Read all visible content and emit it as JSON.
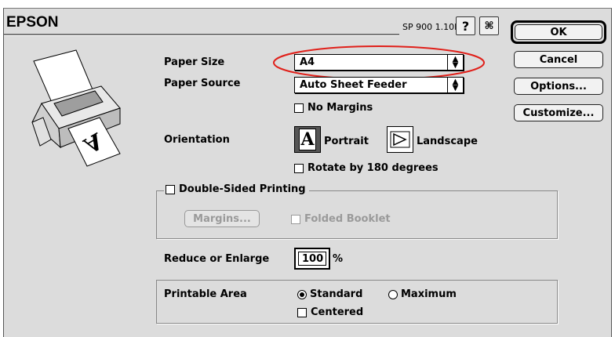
{
  "header": {
    "brand": "EPSON",
    "version": "SP 900 1.10E"
  },
  "toolbar": {
    "help_glyph": "?",
    "prefs_glyph": "⌘"
  },
  "buttons": {
    "ok": "OK",
    "cancel": "Cancel",
    "options": "Options...",
    "customize": "Customize..."
  },
  "paper_size": {
    "label": "Paper Size",
    "value": "A4"
  },
  "paper_source": {
    "label": "Paper Source",
    "value": "Auto Sheet Feeder"
  },
  "no_margins": {
    "label": "No Margins",
    "checked": false
  },
  "orientation": {
    "label": "Orientation",
    "portrait": "Portrait",
    "landscape": "Landscape",
    "selected": "Portrait",
    "portrait_glyph": "A"
  },
  "rotate": {
    "label": "Rotate by 180 degrees",
    "checked": false
  },
  "double_sided": {
    "label": "Double-Sided Printing",
    "checked": false,
    "margins_button": "Margins...",
    "folded_booklet": "Folded Booklet"
  },
  "reduce": {
    "label": "Reduce or Enlarge",
    "value": "100",
    "unit": "%"
  },
  "printable_area": {
    "label": "Printable Area",
    "standard": "Standard",
    "maximum": "Maximum",
    "selected": "Standard",
    "centered": "Centered",
    "centered_checked": false
  },
  "illustration": {
    "paper_glyph": "A"
  },
  "colors": {
    "highlight_ellipse": "#e0201a",
    "dialog_bg": "#dcdcdc"
  }
}
